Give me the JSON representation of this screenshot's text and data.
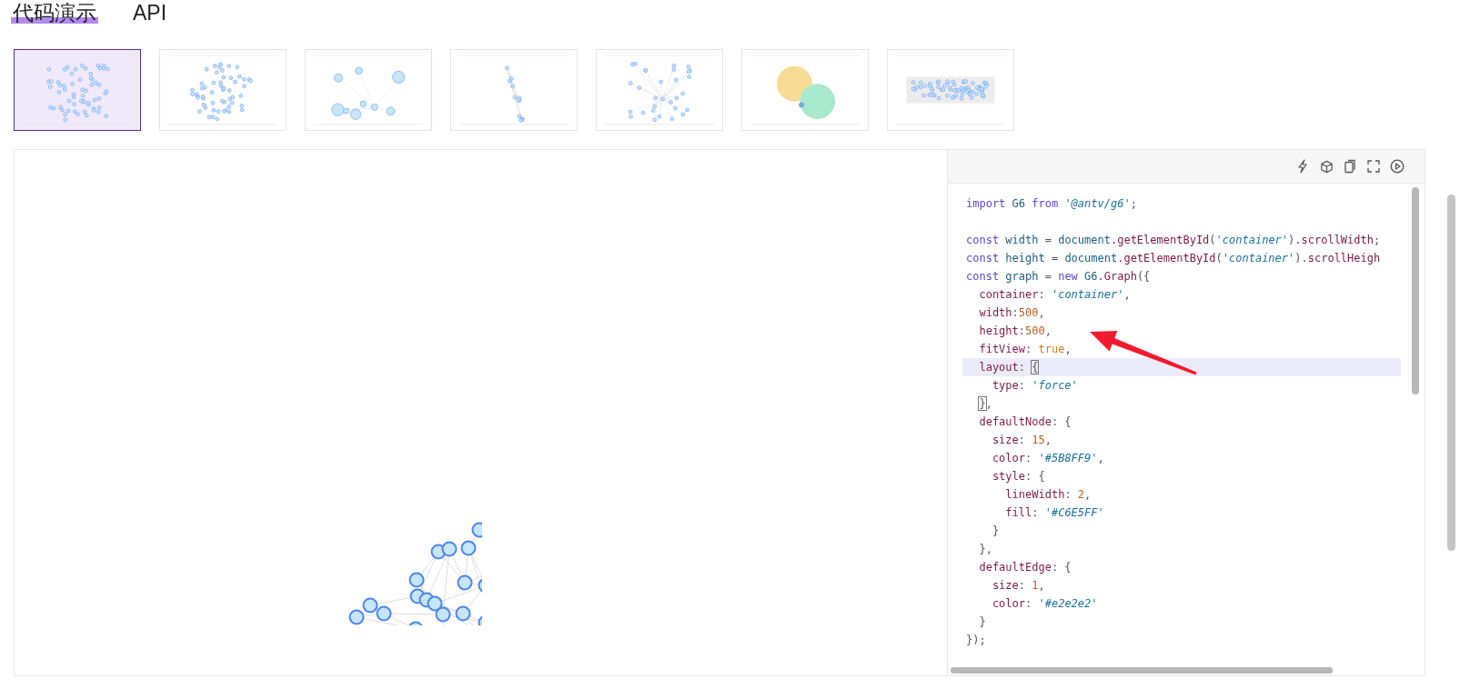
{
  "tabs": [
    {
      "label": "代码演示",
      "selected": true
    },
    {
      "label": "API",
      "selected": false
    }
  ],
  "thumbnails": [
    {
      "selected": true
    },
    {
      "selected": false
    },
    {
      "selected": false
    },
    {
      "selected": false
    },
    {
      "selected": false
    },
    {
      "selected": false
    },
    {
      "selected": false
    }
  ],
  "toolbar": [
    {
      "kind": "lightning"
    },
    {
      "kind": "cube"
    },
    {
      "kind": "copy"
    },
    {
      "kind": "fullscreen"
    },
    {
      "kind": "play"
    }
  ],
  "code": [
    {
      "highlighted": false,
      "tokens": [
        {
          "text": "import",
          "kind": "kw"
        },
        {
          "text": " G6 ",
          "kind": "var"
        },
        {
          "text": "from",
          "kind": "kw"
        },
        {
          "text": " '@antv/g6'",
          "kind": "str"
        },
        {
          "text": ";",
          "kind": "p"
        }
      ]
    },
    {
      "highlighted": false,
      "blank_line_before": true,
      "tokens": [
        {
          "text": "const",
          "kind": "kw"
        },
        {
          "text": " width ",
          "kind": "var"
        },
        {
          "text": "=",
          "kind": "p"
        },
        {
          "text": " document",
          "kind": "var"
        },
        {
          "text": ".getElementById",
          "kind": "fn"
        },
        {
          "text": "(",
          "kind": "p"
        },
        {
          "text": "'container'",
          "kind": "str"
        },
        {
          "text": ")",
          "kind": "p"
        },
        {
          "text": ".scrollWidth",
          "kind": "fn"
        },
        {
          "text": ";",
          "kind": "p"
        }
      ]
    },
    {
      "highlighted": false,
      "tokens": [
        {
          "text": "const",
          "kind": "kw"
        },
        {
          "text": " height ",
          "kind": "var"
        },
        {
          "text": "=",
          "kind": "p"
        },
        {
          "text": " document",
          "kind": "var"
        },
        {
          "text": ".getElementById",
          "kind": "fn"
        },
        {
          "text": "(",
          "kind": "p"
        },
        {
          "text": "'container'",
          "kind": "str"
        },
        {
          "text": ")",
          "kind": "p"
        },
        {
          "text": ".scrollHeigh",
          "kind": "fn"
        }
      ]
    },
    {
      "highlighted": false,
      "tokens": [
        {
          "text": "const",
          "kind": "kw"
        },
        {
          "text": " graph ",
          "kind": "var"
        },
        {
          "text": "=",
          "kind": "p"
        },
        {
          "text": " new",
          "kind": "kw"
        },
        {
          "text": " G6",
          "kind": "var"
        },
        {
          "text": ".Graph",
          "kind": "fn"
        },
        {
          "text": "({",
          "kind": "p"
        }
      ]
    },
    {
      "highlighted": false,
      "tokens": [
        {
          "text": "  container",
          "kind": "fn"
        },
        {
          "text": ": ",
          "kind": "p"
        },
        {
          "text": "'container'",
          "kind": "str"
        },
        {
          "text": ",",
          "kind": "p"
        }
      ]
    },
    {
      "highlighted": false,
      "tokens": [
        {
          "text": "  width",
          "kind": "fn"
        },
        {
          "text": ":",
          "kind": "p"
        },
        {
          "text": "500",
          "kind": "num"
        },
        {
          "text": ",",
          "kind": "p"
        }
      ]
    },
    {
      "highlighted": false,
      "tokens": [
        {
          "text": "  height",
          "kind": "fn"
        },
        {
          "text": ":",
          "kind": "p"
        },
        {
          "text": "500",
          "kind": "num"
        },
        {
          "text": ",",
          "kind": "p"
        }
      ]
    },
    {
      "highlighted": false,
      "tokens": [
        {
          "text": "  fitView",
          "kind": "fn"
        },
        {
          "text": ": ",
          "kind": "p"
        },
        {
          "text": "true",
          "kind": "bool"
        },
        {
          "text": ",",
          "kind": "p"
        }
      ]
    },
    {
      "highlighted": true,
      "tokens": [
        {
          "text": "  layout",
          "kind": "fn"
        },
        {
          "text": ": ",
          "kind": "p"
        },
        {
          "text": "{",
          "kind": "match"
        }
      ]
    },
    {
      "highlighted": false,
      "tokens": [
        {
          "text": "    type",
          "kind": "fn"
        },
        {
          "text": ": ",
          "kind": "p"
        },
        {
          "text": "'force'",
          "kind": "str"
        }
      ]
    },
    {
      "highlighted": false,
      "tokens": [
        {
          "text": "  }",
          "kind": "match"
        },
        {
          "text": ",",
          "kind": "p"
        }
      ]
    },
    {
      "highlighted": false,
      "tokens": [
        {
          "text": "  defaultNode",
          "kind": "fn"
        },
        {
          "text": ": {",
          "kind": "p"
        }
      ]
    },
    {
      "highlighted": false,
      "tokens": [
        {
          "text": "    size",
          "kind": "fn"
        },
        {
          "text": ": ",
          "kind": "p"
        },
        {
          "text": "15",
          "kind": "num"
        },
        {
          "text": ",",
          "kind": "p"
        }
      ]
    },
    {
      "highlighted": false,
      "tokens": [
        {
          "text": "    color",
          "kind": "fn"
        },
        {
          "text": ": ",
          "kind": "p"
        },
        {
          "text": "'#5B8FF9'",
          "kind": "str"
        },
        {
          "text": ",",
          "kind": "p"
        }
      ]
    },
    {
      "highlighted": false,
      "tokens": [
        {
          "text": "    style",
          "kind": "fn"
        },
        {
          "text": ": {",
          "kind": "p"
        }
      ]
    },
    {
      "highlighted": false,
      "tokens": [
        {
          "text": "      lineWidth",
          "kind": "fn"
        },
        {
          "text": ": ",
          "kind": "p"
        },
        {
          "text": "2",
          "kind": "num"
        },
        {
          "text": ",",
          "kind": "p"
        }
      ]
    },
    {
      "highlighted": false,
      "tokens": [
        {
          "text": "      fill",
          "kind": "fn"
        },
        {
          "text": ": ",
          "kind": "p"
        },
        {
          "text": "'#C6E5FF'",
          "kind": "str"
        }
      ]
    },
    {
      "highlighted": false,
      "tokens": [
        {
          "text": "    }",
          "kind": "p"
        }
      ]
    },
    {
      "highlighted": false,
      "tokens": [
        {
          "text": "  },",
          "kind": "p"
        }
      ]
    },
    {
      "highlighted": false,
      "tokens": [
        {
          "text": "  defaultEdge",
          "kind": "fn"
        },
        {
          "text": ": {",
          "kind": "p"
        }
      ]
    },
    {
      "highlighted": false,
      "tokens": [
        {
          "text": "    size",
          "kind": "fn"
        },
        {
          "text": ": ",
          "kind": "p"
        },
        {
          "text": "1",
          "kind": "num"
        },
        {
          "text": ",",
          "kind": "p"
        }
      ]
    },
    {
      "highlighted": false,
      "tokens": [
        {
          "text": "    color",
          "kind": "fn"
        },
        {
          "text": ": ",
          "kind": "p"
        },
        {
          "text": "'#e2e2e2'",
          "kind": "str"
        }
      ]
    },
    {
      "highlighted": false,
      "tokens": [
        {
          "text": "  }",
          "kind": "p"
        }
      ]
    },
    {
      "highlighted": false,
      "tokens": [
        {
          "text": "});",
          "kind": "p"
        }
      ]
    }
  ]
}
